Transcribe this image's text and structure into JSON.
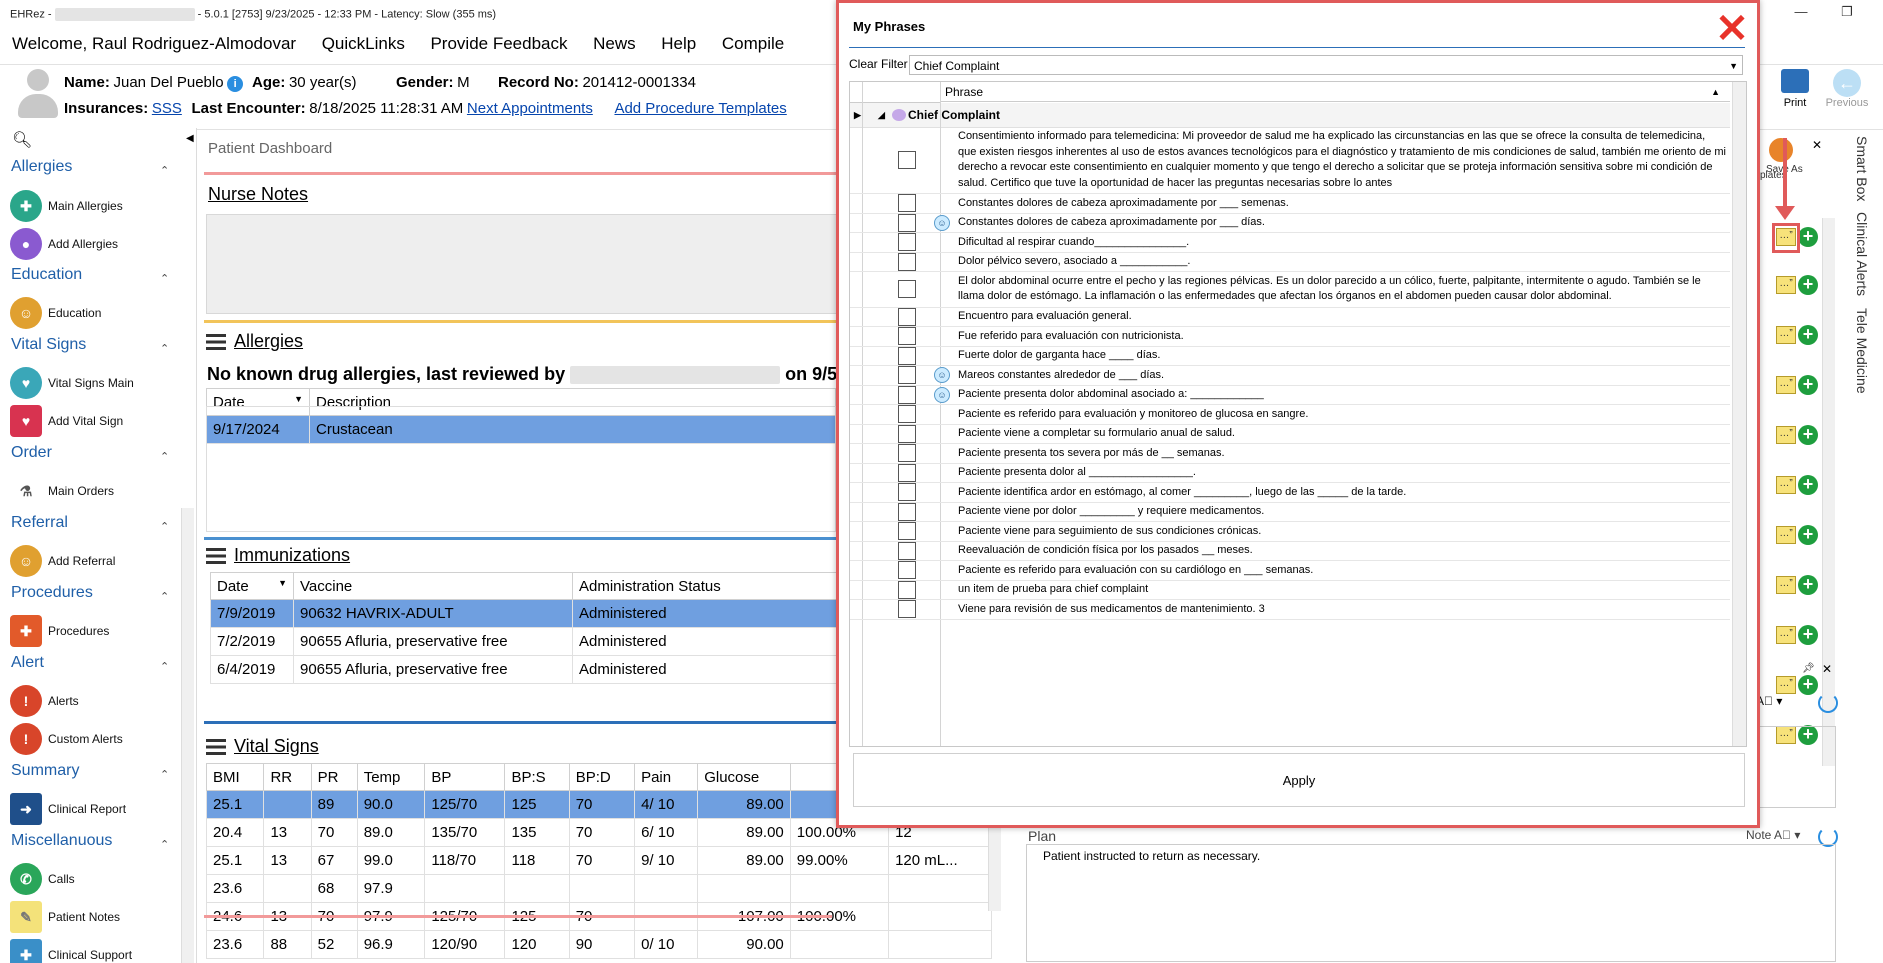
{
  "titlebar": {
    "app": "EHRez - ",
    "info": " - 5.0.1 [2753] 9/23/2025 - 12:33 PM - Latency: Slow (355 ms)"
  },
  "menu": [
    "Welcome, Raul Rodriguez-Almodovar",
    "QuickLinks",
    "Provide Feedback",
    "News",
    "Help",
    "Compile"
  ],
  "patient": {
    "name_label": "Name:",
    "name": "Juan Del Pueblo",
    "age_label": "Age:",
    "age": "30 year(s)",
    "gender_label": "Gender:",
    "gender": "M",
    "record_label": "Record No:",
    "record": "201412-0001334",
    "insurances_label": "Insurances:",
    "insurance": "SSS",
    "last_encounter_label": "Last Encounter:",
    "last_encounter": "8/18/2025 11:28:31 AM",
    "next_appointments": "Next Appointments",
    "add_procedure_templates": "Add Procedure Templates"
  },
  "toolbar": {
    "print": "Print",
    "previous": "Previous",
    "templates": "plates",
    "save_as": "Save As"
  },
  "leftnav": {
    "sections": [
      {
        "title": "Allergies",
        "items": [
          "Main Allergies",
          "Add Allergies"
        ]
      },
      {
        "title": "Education",
        "items": [
          "Education"
        ]
      },
      {
        "title": "Vital Signs",
        "items": [
          "Vital Signs Main",
          "Add Vital Sign"
        ]
      },
      {
        "title": "Order",
        "items": [
          "Main Orders"
        ]
      },
      {
        "title": "Referral",
        "items": [
          "Add Referral"
        ]
      },
      {
        "title": "Procedures",
        "items": [
          "Procedures"
        ]
      },
      {
        "title": "Alert",
        "items": [
          "Alerts",
          "Custom Alerts"
        ]
      },
      {
        "title": "Summary",
        "items": [
          "Clinical Report"
        ]
      },
      {
        "title": "Miscellanuous",
        "items": [
          "Calls",
          "Patient Notes",
          "Clinical Support"
        ]
      }
    ]
  },
  "dashboard": {
    "title": "Patient Dashboard",
    "nurse_notes": "Nurse Notes",
    "allergies": {
      "title": "Allergies",
      "summary": "No known drug allergies, last reviewed by",
      "summary_date": "on 9/5/",
      "headers": [
        "Date",
        "Description"
      ],
      "rows": [
        [
          "9/17/2024",
          "Crustacean"
        ]
      ]
    },
    "immunizations": {
      "title": "Immunizations",
      "headers": [
        "Date",
        "Vaccine",
        "Administration Status"
      ],
      "rows": [
        [
          "7/9/2019",
          "90632 HAVRIX-ADULT",
          "Administered"
        ],
        [
          "7/2/2019",
          "90655 Afluria, preservative free",
          "Administered"
        ],
        [
          "6/4/2019",
          "90655 Afluria, preservative free",
          "Administered"
        ]
      ]
    },
    "vitals": {
      "title": "Vital Signs",
      "headers": [
        "BMI",
        "RR",
        "PR",
        "Temp",
        "BP",
        "BP:S",
        "BP:D",
        "Pain",
        "Glucose",
        "",
        ""
      ],
      "rows": [
        [
          "25.1",
          "",
          "89",
          "90.0",
          "125/70",
          "125",
          "70",
          "4/ 10",
          "89.00",
          "",
          ""
        ],
        [
          "20.4",
          "13",
          "70",
          "89.0",
          "135/70",
          "135",
          "70",
          "6/ 10",
          "89.00",
          "100.00%",
          "12"
        ],
        [
          "25.1",
          "13",
          "67",
          "99.0",
          "118/70",
          "118",
          "70",
          "9/ 10",
          "89.00",
          "99.00%",
          "120 mL..."
        ],
        [
          "23.6",
          "",
          "68",
          "97.9",
          "",
          "",
          "",
          "",
          "",
          "",
          ""
        ],
        [
          "24.6",
          "13",
          "70",
          "97.9",
          "125/70",
          "125",
          "70",
          "",
          "107.00",
          "100.00%",
          ""
        ],
        [
          "23.6",
          "88",
          "52",
          "96.9",
          "120/90",
          "120",
          "90",
          "0/ 10",
          "90.00",
          "",
          ""
        ]
      ]
    }
  },
  "right": {
    "vtabs": [
      "Smart Box",
      "Clinical Alerts",
      "Tele Medicine"
    ],
    "plan_label": "Plan",
    "note_label": "Note",
    "plan_text": "Patient instructed to return as necessary."
  },
  "modal": {
    "title": "My Phrases",
    "clear_filter": "Clear Filter",
    "filter_value": "Chief Complaint",
    "column": "Phrase",
    "group": "Chief Complaint",
    "apply": "Apply",
    "phrases": [
      {
        "text": "Consentimiento informado para telemedicina:  Mi proveedor de salud me ha explicado las circunstancias en las que se ofrece la consulta de telemedicina, que existen riesgos inherentes al uso de estos avances tecnológicos para el diagnóstico y tratamiento de mis condiciones de salud, también me oriento de mi derecho a revocar este consentimiento en cualquier momento y que tengo el derecho a solicitar que se proteja información sensitiva sobre mi condición de salud.  Certifico que tuve la oportunidad de hacer las preguntas necesarias sobre lo antes",
        "icon": false
      },
      {
        "text": "Constantes dolores de cabeza aproximadamente por ___ semenas.",
        "icon": false
      },
      {
        "text": "Constantes dolores de cabeza aproximadamente por ___ días.",
        "icon": true
      },
      {
        "text": "Dificultad al respirar cuando_______________.",
        "icon": false
      },
      {
        "text": "Dolor pélvico severo, asociado a ___________.",
        "icon": false
      },
      {
        "text": "El dolor abdominal ocurre entre el pecho y las regiones pélvicas. Es un dolor parecido a un cólico, fuerte, palpitante, intermitente o agudo. También se le llama dolor de estómago. La inflamación o las enfermedades que afectan los órganos en el abdomen pueden causar dolor abdominal.",
        "icon": false
      },
      {
        "text": "Encuentro para evaluación general.",
        "icon": false
      },
      {
        "text": "Fue referido para evaluación con nutricionista.",
        "icon": false
      },
      {
        "text": "Fuerte dolor de garganta hace ____ días.",
        "icon": false
      },
      {
        "text": "Mareos constantes alrededor de ___ días.",
        "icon": true
      },
      {
        "text": "Paciente presenta dolor abdominal asociado a: ____________",
        "icon": true
      },
      {
        "text": "Paciente es referido para evaluación y monitoreo de glucosa en sangre.",
        "icon": false
      },
      {
        "text": "Paciente viene a completar su formulario anual de salud.",
        "icon": false
      },
      {
        "text": "Paciente presenta tos severa por más de __ semanas.",
        "icon": false
      },
      {
        "text": "Paciente presenta dolor al _________________.",
        "icon": false
      },
      {
        "text": "Paciente identifica ardor en estómago, al comer _________, luego de las _____ de la tarde.",
        "icon": false
      },
      {
        "text": "Paciente viene por dolor _________ y requiere medicamentos.",
        "icon": false
      },
      {
        "text": "Paciente viene para seguimiento de sus condiciones crónicas.",
        "icon": false
      },
      {
        "text": "Reevaluación de condición física por los pasados __ meses.",
        "icon": false
      },
      {
        "text": "Paciente es referido para evaluación con su cardiólogo en ___ semanas.",
        "icon": false
      },
      {
        "text": "un item de prueba para chief complaint",
        "icon": false
      },
      {
        "text": "Viene para revisión de sus medicamentos de mantenimiento. 3",
        "icon": false
      }
    ]
  },
  "colors": {
    "accent": "#1f5fa8",
    "modal_border": "#e05a5a",
    "close": "#e8322a",
    "selected_row": "#6f9fe0"
  }
}
